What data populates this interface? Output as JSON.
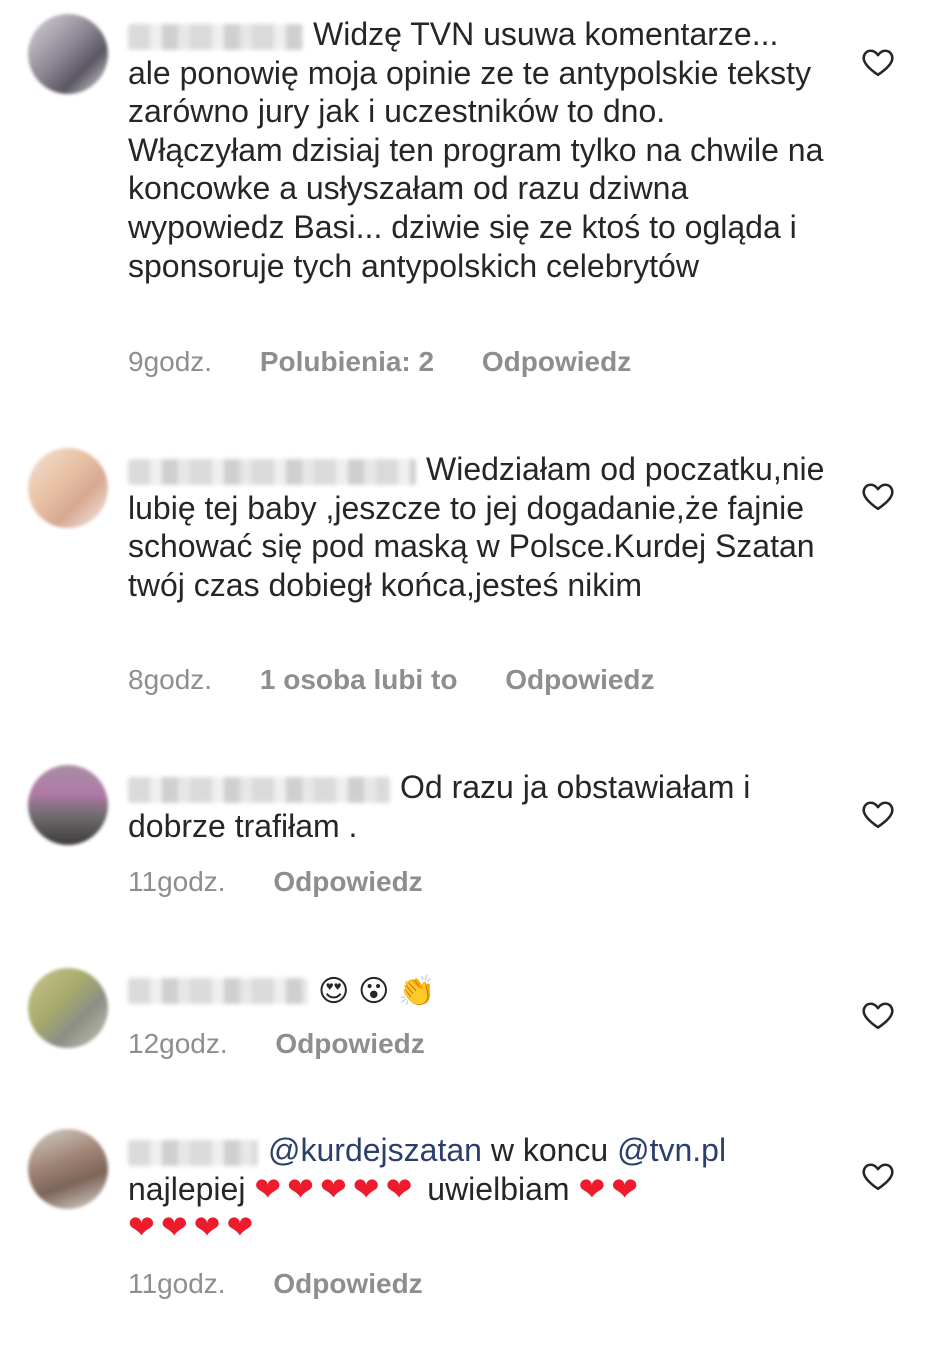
{
  "comments": [
    {
      "text": "Widzę TVN usuwa komentarze... ale ponowię moja opinie ze te antypolskie teksty zarówno jury jak i uczestników to dno. Włączyłam dzisiaj ten program tylko na chwile na koncowke a usłyszałam od razu dziwna wypowiedz Basi... dziwie się ze ktoś to ogląda i sponsoruje tych antypolskich celebrytów",
      "time": "9godz.",
      "likes": "Polubienia: 2",
      "reply": "Odpowiedz",
      "like_icon": "heart-outline-icon"
    },
    {
      "text": "Wiedziałam od poczatku,nie lubię tej baby ,jeszcze to jej dogadanie,że fajnie schować się pod maską w Polsce.Kurdej Szatan twój czas dobiegł końca,jesteś nikim",
      "time": "8godz.",
      "likes": "1 osoba lubi to",
      "reply": "Odpowiedz",
      "like_icon": "heart-outline-icon"
    },
    {
      "text": "Od razu ja obstawiałam i dobrze trafiłam .",
      "time": "11godz.",
      "reply": "Odpowiedz",
      "like_icon": "heart-outline-icon"
    },
    {
      "emoji1": "😍",
      "emoji2": "😮",
      "emoji3": "👏",
      "time": "12godz.",
      "reply": "Odpowiedz",
      "like_icon": "heart-outline-icon"
    },
    {
      "mention1": "@kurdejszatan",
      "mid": " w koncu ",
      "mention2": "@tvn.pl",
      "word1": "najlepiej",
      "hearts1": "❤❤❤❤❤",
      "word2": "uwielbiam",
      "hearts2": "❤❤",
      "hearts3": "❤❤❤❤",
      "time": "11godz.",
      "reply": "Odpowiedz",
      "like_icon": "heart-outline-icon"
    }
  ],
  "colors": {
    "text": "#262626",
    "meta": "#8e8e8e",
    "mention": "#2b3f6b",
    "heart_emoji": "#ed1c2c"
  }
}
